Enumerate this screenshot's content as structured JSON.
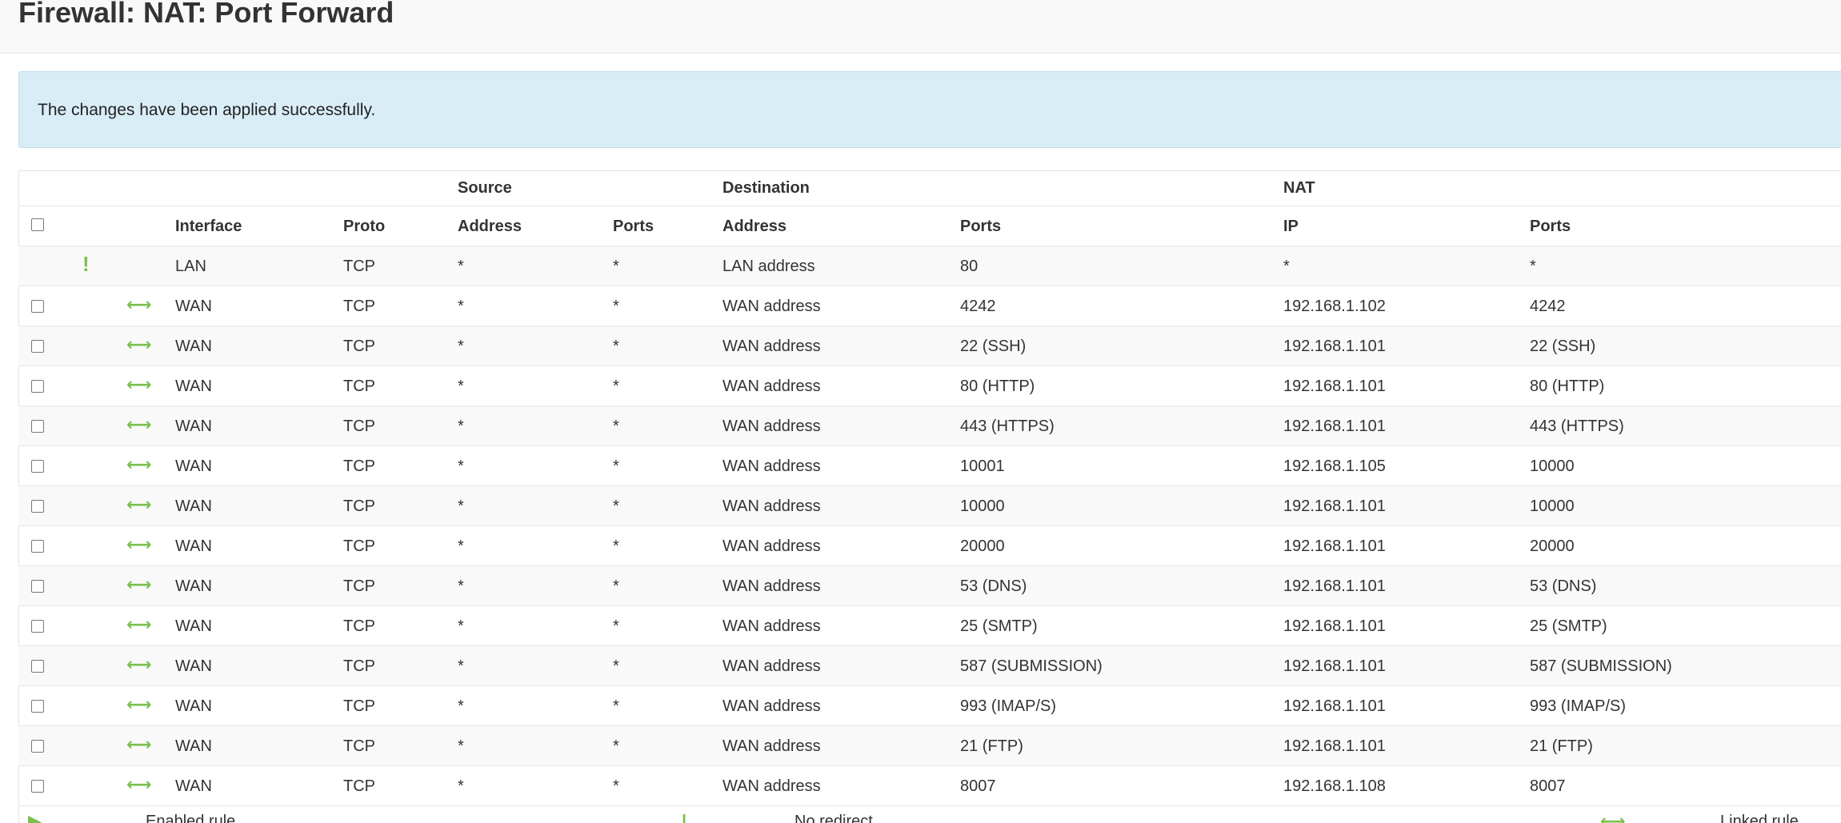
{
  "page": {
    "title": "Firewall: NAT: Port Forward"
  },
  "alert": {
    "message": "The changes have been applied successfully."
  },
  "table": {
    "group_headers": {
      "source": "Source",
      "destination": "Destination",
      "nat": "NAT"
    },
    "columns": {
      "interface": "Interface",
      "proto": "Proto",
      "src_address": "Address",
      "src_ports": "Ports",
      "dst_address": "Address",
      "dst_ports": "Ports",
      "nat_ip": "IP",
      "nat_ports": "Ports"
    },
    "rows": [
      {
        "has_checkbox": false,
        "icon": "exclamation-icon",
        "interface": "LAN",
        "proto": "TCP",
        "src_address": "*",
        "src_ports": "*",
        "dst_address": "LAN address",
        "dst_ports": "80",
        "nat_ip": "*",
        "nat_ports": "*"
      },
      {
        "has_checkbox": true,
        "icon": "port-forward-arrows-icon",
        "interface": "WAN",
        "proto": "TCP",
        "src_address": "*",
        "src_ports": "*",
        "dst_address": "WAN address",
        "dst_ports": "4242",
        "nat_ip": "192.168.1.102",
        "nat_ports": "4242"
      },
      {
        "has_checkbox": true,
        "icon": "port-forward-arrows-icon",
        "interface": "WAN",
        "proto": "TCP",
        "src_address": "*",
        "src_ports": "*",
        "dst_address": "WAN address",
        "dst_ports": "22 (SSH)",
        "nat_ip": "192.168.1.101",
        "nat_ports": "22 (SSH)"
      },
      {
        "has_checkbox": true,
        "icon": "port-forward-arrows-icon",
        "interface": "WAN",
        "proto": "TCP",
        "src_address": "*",
        "src_ports": "*",
        "dst_address": "WAN address",
        "dst_ports": "80 (HTTP)",
        "nat_ip": "192.168.1.101",
        "nat_ports": "80 (HTTP)"
      },
      {
        "has_checkbox": true,
        "icon": "port-forward-arrows-icon",
        "interface": "WAN",
        "proto": "TCP",
        "src_address": "*",
        "src_ports": "*",
        "dst_address": "WAN address",
        "dst_ports": "443 (HTTPS)",
        "nat_ip": "192.168.1.101",
        "nat_ports": "443 (HTTPS)"
      },
      {
        "has_checkbox": true,
        "icon": "port-forward-arrows-icon",
        "interface": "WAN",
        "proto": "TCP",
        "src_address": "*",
        "src_ports": "*",
        "dst_address": "WAN address",
        "dst_ports": "10001",
        "nat_ip": "192.168.1.105",
        "nat_ports": "10000"
      },
      {
        "has_checkbox": true,
        "icon": "port-forward-arrows-icon",
        "interface": "WAN",
        "proto": "TCP",
        "src_address": "*",
        "src_ports": "*",
        "dst_address": "WAN address",
        "dst_ports": "10000",
        "nat_ip": "192.168.1.101",
        "nat_ports": "10000"
      },
      {
        "has_checkbox": true,
        "icon": "port-forward-arrows-icon",
        "interface": "WAN",
        "proto": "TCP",
        "src_address": "*",
        "src_ports": "*",
        "dst_address": "WAN address",
        "dst_ports": "20000",
        "nat_ip": "192.168.1.101",
        "nat_ports": "20000"
      },
      {
        "has_checkbox": true,
        "icon": "port-forward-arrows-icon",
        "interface": "WAN",
        "proto": "TCP",
        "src_address": "*",
        "src_ports": "*",
        "dst_address": "WAN address",
        "dst_ports": "53 (DNS)",
        "nat_ip": "192.168.1.101",
        "nat_ports": "53 (DNS)"
      },
      {
        "has_checkbox": true,
        "icon": "port-forward-arrows-icon",
        "interface": "WAN",
        "proto": "TCP",
        "src_address": "*",
        "src_ports": "*",
        "dst_address": "WAN address",
        "dst_ports": "25 (SMTP)",
        "nat_ip": "192.168.1.101",
        "nat_ports": "25 (SMTP)"
      },
      {
        "has_checkbox": true,
        "icon": "port-forward-arrows-icon",
        "interface": "WAN",
        "proto": "TCP",
        "src_address": "*",
        "src_ports": "*",
        "dst_address": "WAN address",
        "dst_ports": "587 (SUBMISSION)",
        "nat_ip": "192.168.1.101",
        "nat_ports": "587 (SUBMISSION)"
      },
      {
        "has_checkbox": true,
        "icon": "port-forward-arrows-icon",
        "interface": "WAN",
        "proto": "TCP",
        "src_address": "*",
        "src_ports": "*",
        "dst_address": "WAN address",
        "dst_ports": "993 (IMAP/S)",
        "nat_ip": "192.168.1.101",
        "nat_ports": "993 (IMAP/S)"
      },
      {
        "has_checkbox": true,
        "icon": "port-forward-arrows-icon",
        "interface": "WAN",
        "proto": "TCP",
        "src_address": "*",
        "src_ports": "*",
        "dst_address": "WAN address",
        "dst_ports": "21 (FTP)",
        "nat_ip": "192.168.1.101",
        "nat_ports": "21 (FTP)"
      },
      {
        "has_checkbox": true,
        "icon": "port-forward-arrows-icon",
        "interface": "WAN",
        "proto": "TCP",
        "src_address": "*",
        "src_ports": "*",
        "dst_address": "WAN address",
        "dst_ports": "8007",
        "nat_ip": "192.168.1.108",
        "nat_ports": "8007"
      }
    ]
  },
  "legend": {
    "enabled_label": "Enabled rule",
    "no_redirect_label": "No redirect",
    "linked_label": "Linked rule"
  },
  "colors": {
    "accent_green": "#7dbf4e",
    "alert_background": "#d9edf7",
    "alert_border": "#bcdff1"
  }
}
